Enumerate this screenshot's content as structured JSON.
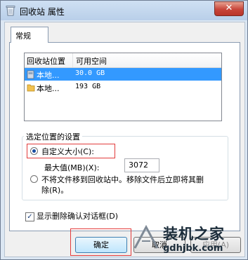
{
  "window": {
    "title": "回收站 属性",
    "close_label": "✕"
  },
  "tabs": [
    {
      "label": "常规"
    }
  ],
  "list": {
    "columns": [
      "回收站位置",
      "可用空间"
    ],
    "rows": [
      {
        "name": "本地...",
        "space": "30.0 GB",
        "selected": true
      },
      {
        "name": "本地...",
        "space": "193 GB",
        "selected": false
      }
    ]
  },
  "settings": {
    "group_title": "选定位置的设置",
    "custom_size_label": "自定义大小(C):",
    "max_label": "最大值(MB)(X):",
    "max_value": "3072",
    "delete_option_line1": "不将文件移到回收站中。移除文件后立即将其删",
    "delete_option_line2": "除(R)。",
    "selected_option": "custom_size"
  },
  "confirm": {
    "label": "显示删除确认对话框(D)",
    "checked": true
  },
  "buttons": {
    "ok": "确定",
    "cancel": "取消",
    "apply": "应用(A)"
  },
  "watermark": {
    "text": "装机之家",
    "url": "gdhjbk.com"
  },
  "colors": {
    "selection": "#3399ff",
    "highlight_border": "#e23b3b",
    "titlebar": "#c4d7ee"
  }
}
